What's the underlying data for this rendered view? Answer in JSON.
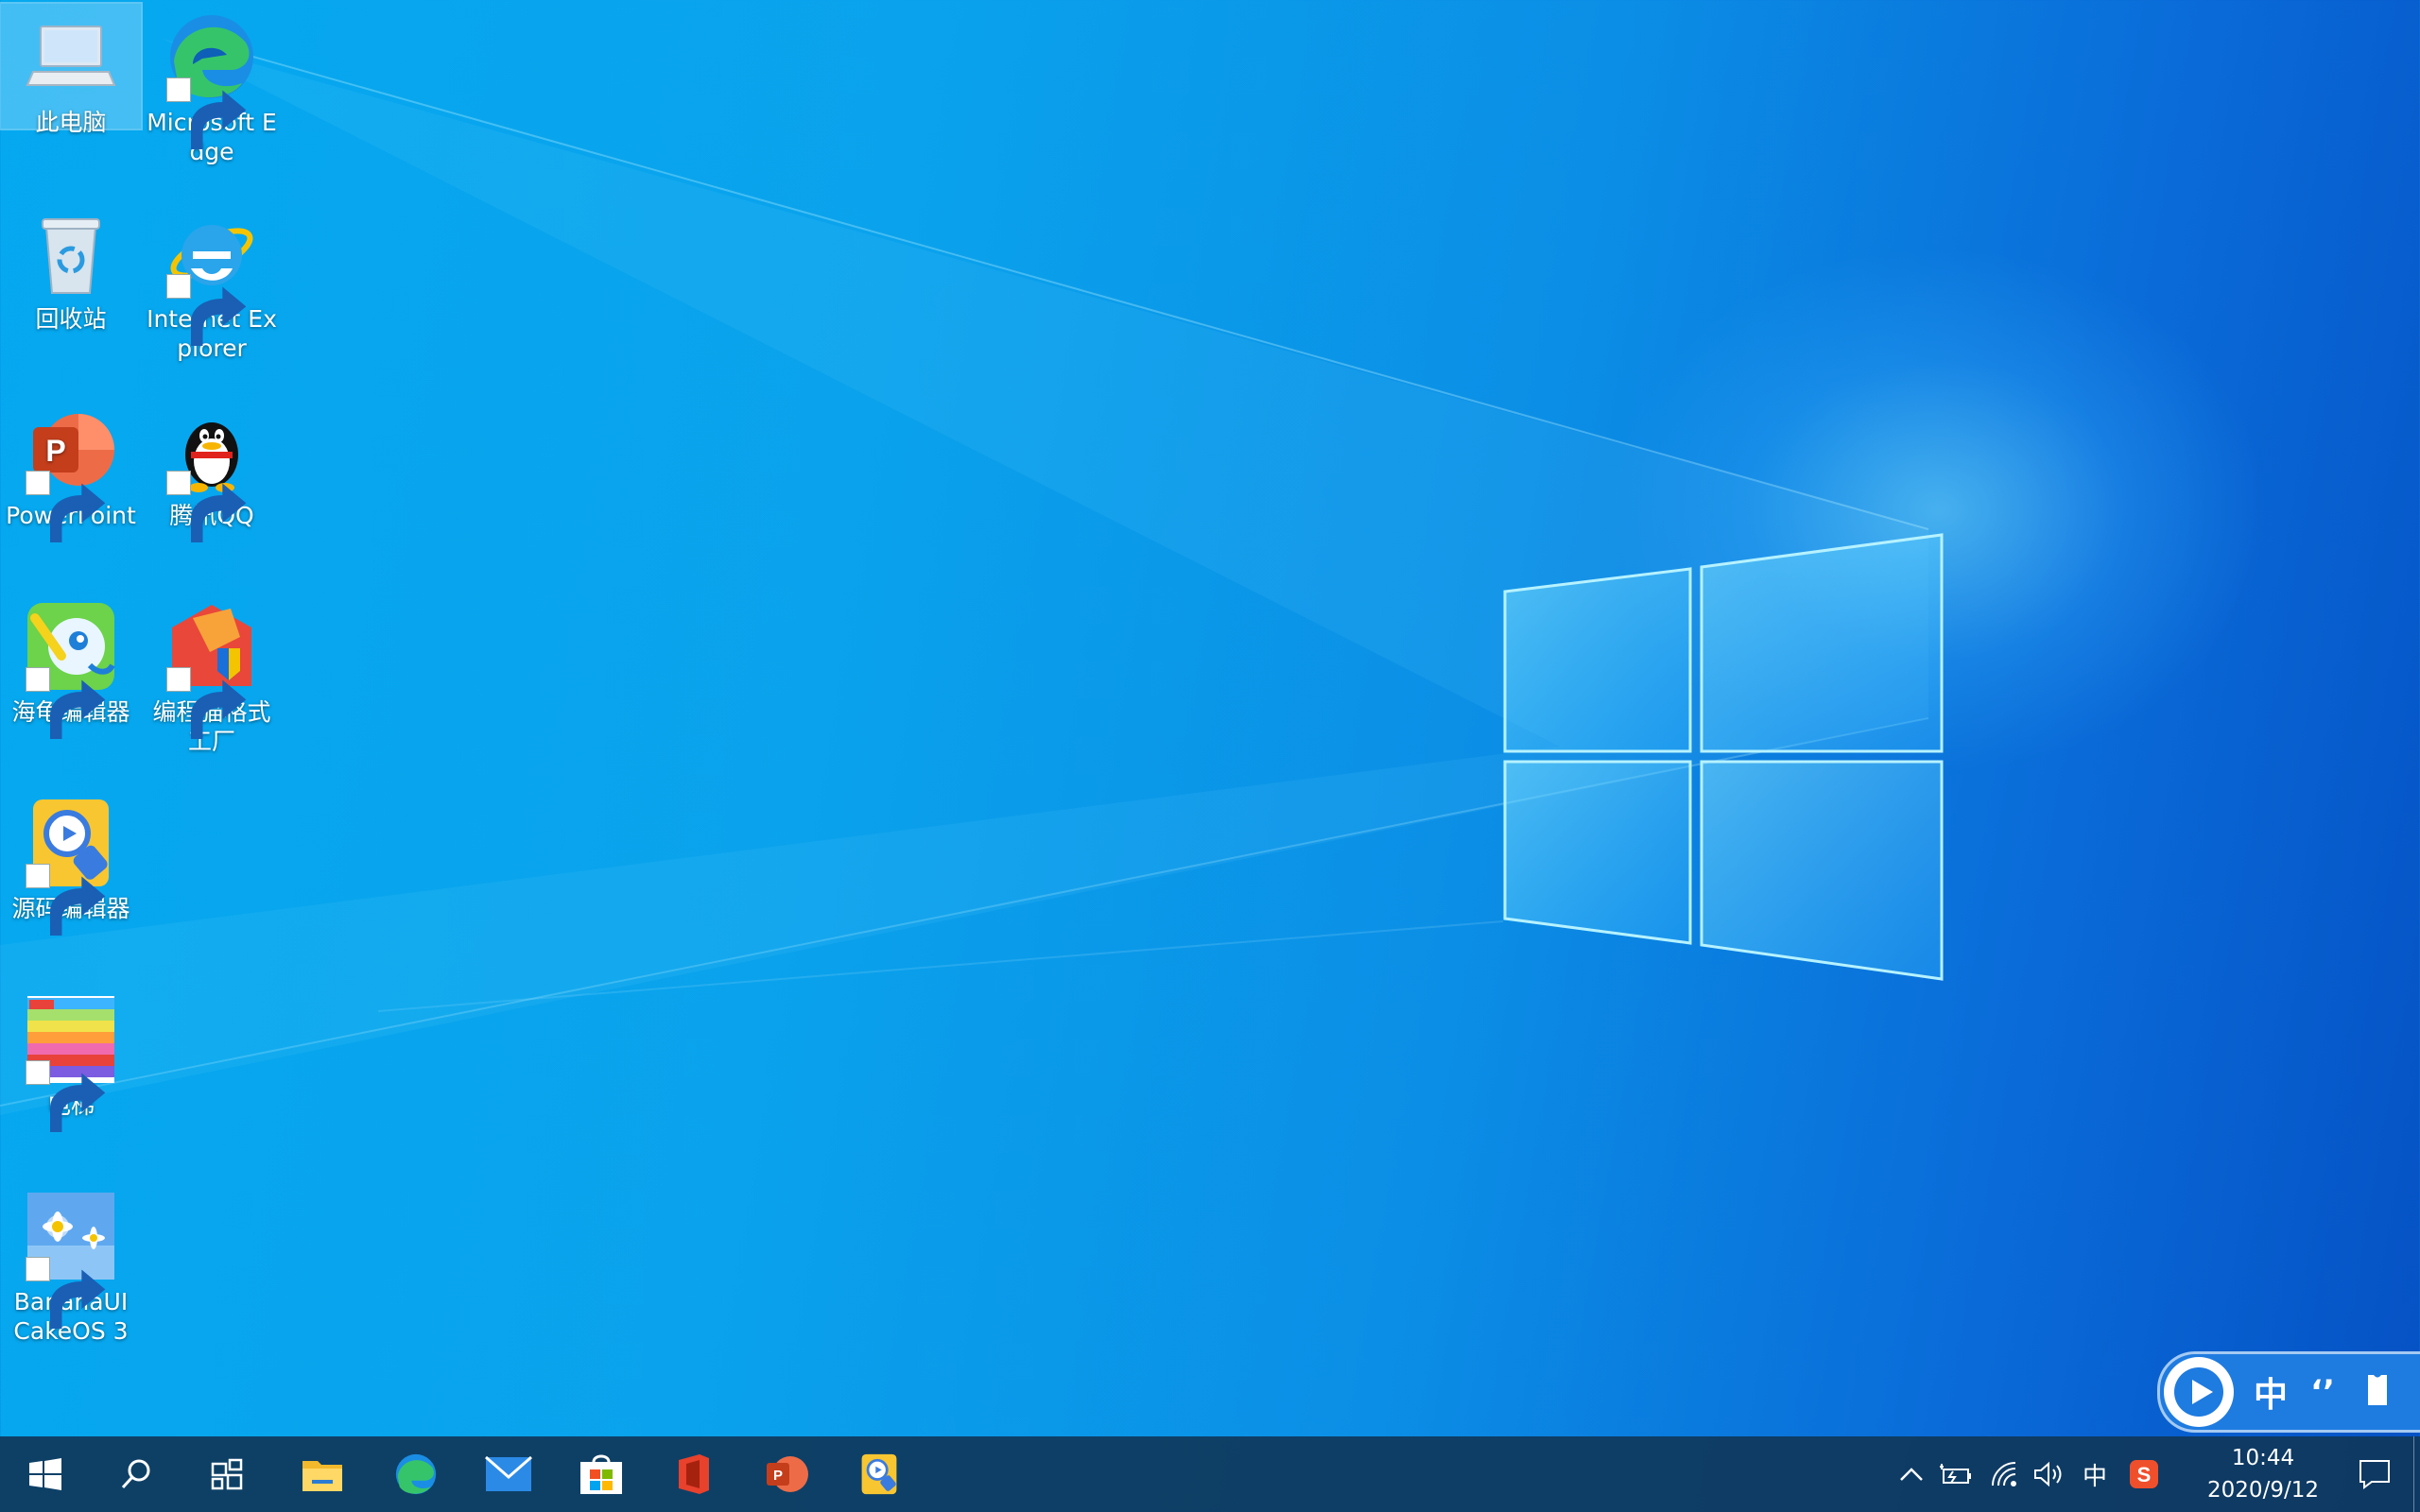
{
  "desktop": {
    "icons": [
      {
        "label": "此电脑",
        "icon": "this-pc-icon",
        "selected": true
      },
      {
        "label": "Microsoft Edge",
        "icon": "edge-icon",
        "shortcut": true
      },
      {
        "label": "回收站",
        "icon": "recycle-bin-icon"
      },
      {
        "label": "Internet Explorer",
        "icon": "internet-explorer-icon",
        "shortcut": true
      },
      {
        "label": "PowerPoint",
        "icon": "powerpoint-icon",
        "shortcut": true
      },
      {
        "label": "腾讯QQ",
        "icon": "qq-icon",
        "shortcut": true
      },
      {
        "label": "海龟编辑器",
        "icon": "turtle-editor-icon",
        "shortcut": true
      },
      {
        "label": "编程猫格式工厂",
        "icon": "codemao-format-factory-icon",
        "shortcut": true
      },
      {
        "label": "源码编辑器",
        "icon": "source-code-editor-icon",
        "shortcut": true
      },
      {
        "label": "电梯",
        "icon": "elevator-icon",
        "shortcut": true
      },
      {
        "label": "BananaUI CakeOS 3",
        "icon": "bananaui-cakeos-icon",
        "shortcut": true
      }
    ]
  },
  "ime_toolbar": {
    "mode": "中",
    "punctuation": "‘’",
    "icons": [
      "play-icon",
      "chinese-mode-label",
      "punctuation-icon",
      "clothes-icon"
    ]
  },
  "taskbar": {
    "pinned": [
      "start-windows-icon",
      "search-icon",
      "task-view-icon",
      "file-explorer-icon",
      "edge-icon",
      "mail-icon",
      "store-icon",
      "office-icon",
      "powerpoint-icon",
      "source-code-editor-icon"
    ],
    "tray": {
      "input_language": "中",
      "time": "10:44",
      "date": "2020/9/12",
      "icons": [
        "chevron-up-icon",
        "battery-icon",
        "wifi-icon",
        "volume-icon",
        "sogou-icon",
        "notification-icon"
      ]
    }
  },
  "colors": {
    "wallpaper_light": "#05a9f0",
    "wallpaper_dark": "#0551c4",
    "taskbar": "#0f375a",
    "ime_toolbar": "#1e7be0"
  }
}
